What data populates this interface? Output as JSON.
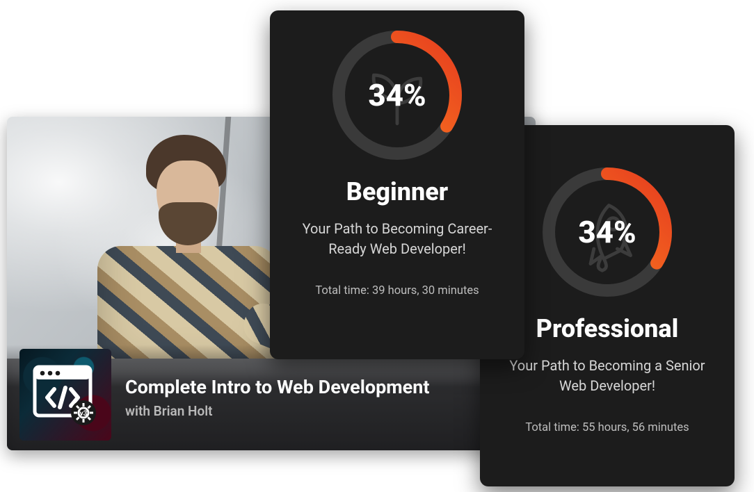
{
  "course": {
    "title": "Complete Intro to Web Development",
    "instructor_prefix": "with ",
    "instructor": "Brian Holt",
    "thumb_badge": "v3",
    "thumb_icon_name": "code-window-icon"
  },
  "paths": {
    "beginner": {
      "percent_label": "34%",
      "percent_value": 34,
      "title": "Beginner",
      "description": "Your Path to Becoming Career-Ready Web Developer!",
      "total_time_label": "Total time: 39 hours, 30 minutes",
      "bg_icon_name": "seedling-icon"
    },
    "professional": {
      "percent_label": "34%",
      "percent_value": 34,
      "title": "Professional",
      "description": "Your Path to Becoming a Senior Web Developer!",
      "total_time_label": "Total time: 55 hours, 56 minutes",
      "bg_icon_name": "rocket-icon"
    }
  },
  "colors": {
    "accent_start": "#e63d1f",
    "accent_end": "#ff8a1f",
    "ring_track": "#3a3a3a",
    "card_bg": "#1c1c1c"
  }
}
